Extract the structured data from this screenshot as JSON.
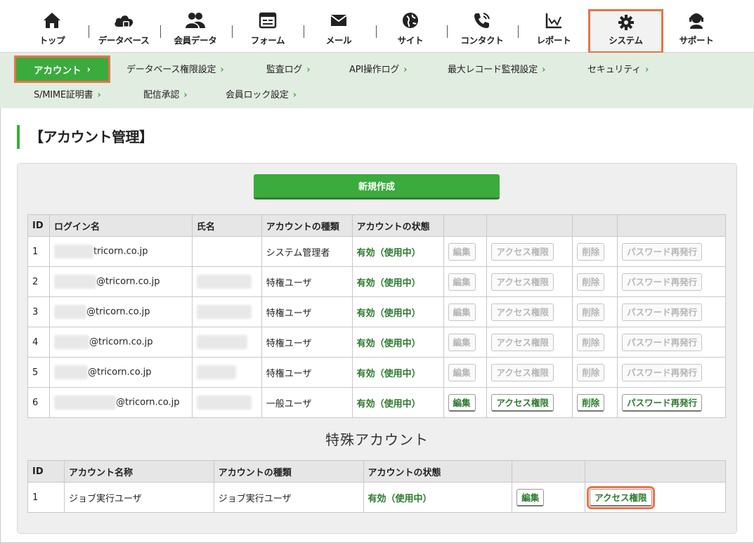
{
  "nav": [
    {
      "label": "トップ",
      "icon": "home-icon"
    },
    {
      "label": "データベース",
      "icon": "cloud-icon"
    },
    {
      "label": "会員データ",
      "icon": "users-icon"
    },
    {
      "label": "フォーム",
      "icon": "form-icon"
    },
    {
      "label": "メール",
      "icon": "mail-icon"
    },
    {
      "label": "サイト",
      "icon": "globe-icon"
    },
    {
      "label": "コンタクト",
      "icon": "phone-icon"
    },
    {
      "label": "レポート",
      "icon": "chart-icon"
    },
    {
      "label": "システム",
      "icon": "gear-icon"
    },
    {
      "label": "サポート",
      "icon": "support-icon"
    }
  ],
  "subnav": {
    "active": "アカウント",
    "items": [
      "データベース権限設定",
      "監査ログ",
      "API操作ログ",
      "最大レコード監視設定",
      "セキュリティ",
      "S/MIME証明書",
      "配信承認",
      "会員ロック設定"
    ]
  },
  "page_title": "【アカウント管理】",
  "new_button": "新規作成",
  "accounts": {
    "headers": [
      "ID",
      "ログイン名",
      "氏名",
      "アカウントの種類",
      "アカウントの状態"
    ],
    "rows": [
      {
        "id": "1",
        "login": "tricorn.co.jp",
        "type": "システム管理者",
        "status": "有効（使用中）"
      },
      {
        "id": "2",
        "login": "@tricorn.co.jp",
        "type": "特権ユーザ",
        "status": "有効（使用中）"
      },
      {
        "id": "3",
        "login": "@tricorn.co.jp",
        "type": "特権ユーザ",
        "status": "有効（使用中）"
      },
      {
        "id": "4",
        "login": "@tricorn.co.jp",
        "type": "特権ユーザ",
        "status": "有効（使用中）"
      },
      {
        "id": "5",
        "login": "@tricorn.co.jp",
        "type": "特権ユーザ",
        "status": "有効（使用中）"
      },
      {
        "id": "6",
        "login": "@tricorn.co.jp",
        "type": "一般ユーザ",
        "status": "有効（使用中）"
      }
    ],
    "actions": {
      "edit": "編集",
      "access": "アクセス権限",
      "delete": "削除",
      "reissue": "パスワード再発行"
    }
  },
  "special": {
    "title": "特殊アカウント",
    "headers": [
      "ID",
      "アカウント名称",
      "アカウントの種類",
      "アカウントの状態"
    ],
    "rows": [
      {
        "id": "1",
        "name": "ジョブ実行ユーザ",
        "type": "ジョブ実行ユーザ",
        "status": "有効（使用中）"
      }
    ],
    "actions": {
      "edit": "編集",
      "access": "アクセス権限"
    }
  },
  "colors": {
    "accent": "#3bab3d",
    "highlight": "#e8734a",
    "subnav_bg": "#e2ede1"
  }
}
